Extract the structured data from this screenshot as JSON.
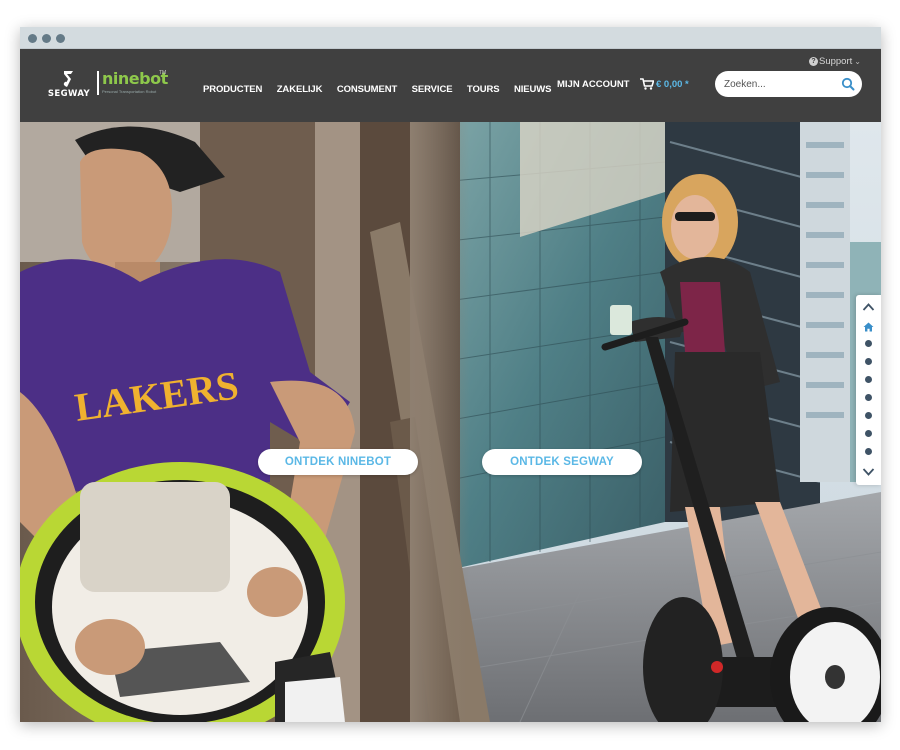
{
  "header": {
    "support_label": "Support",
    "logo_segway": "SEGWAY",
    "logo_ninebot": "ninebot",
    "logo_ninebot_tag": "Personal Transportation Robot",
    "nav": [
      "PRODUCTEN",
      "ZAKELIJK",
      "CONSUMENT",
      "SERVICE",
      "TOURS",
      "NIEUWS"
    ],
    "account_label": "MIJN ACCOUNT",
    "cart_amount": "€ 0,00 *",
    "search_placeholder": "Zoeken..."
  },
  "hero": {
    "cta_ninebot": "ONTDEK NINEBOT",
    "cta_segway": "ONTDEK SEGWAY",
    "shirt_text": "LAKERS"
  },
  "colors": {
    "header_bg": "#404040",
    "accent": "#5bb8e6",
    "ninebot_green": "#8ec84b",
    "chrome": "#d3dbdf"
  },
  "icons": {
    "support": "question-circle-icon",
    "cart": "cart-icon",
    "search": "search-icon",
    "side_up": "chevron-up-icon",
    "side_home": "home-icon",
    "side_down": "chevron-down-icon"
  }
}
